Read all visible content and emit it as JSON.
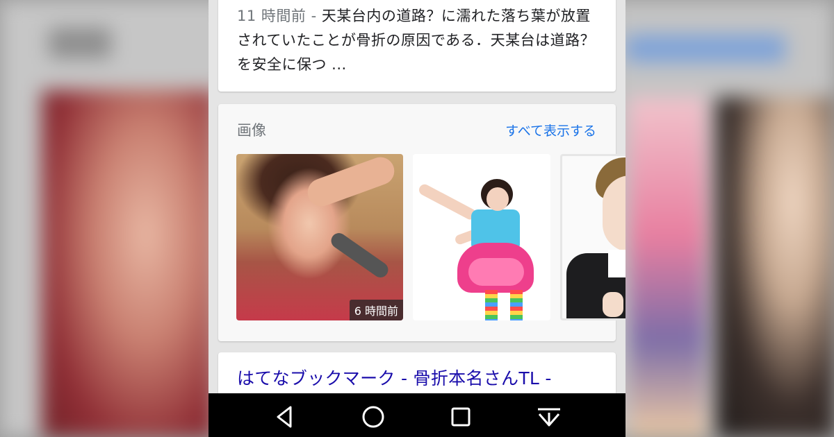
{
  "snippet": {
    "timestamp": "11 時間前 - ",
    "text": "天某台内の道路？に濡れた落ち葉が放置されていたことが骨折の原因である．天某台は道路？を安全に保つ ..."
  },
  "images_section": {
    "title": "画像",
    "show_all": "すべて表示する",
    "thumbnails": [
      {
        "icon": "singer-with-microphone-photo",
        "badge": "6 時間前"
      },
      {
        "icon": "colorful-costume-dancer-photo"
      },
      {
        "icon": "person-in-black-suit-photo"
      }
    ]
  },
  "result": {
    "link_text": "はてなブックマーク - 骨折本名さんTL -"
  },
  "navbar": {
    "buttons": [
      {
        "icon": "back-icon"
      },
      {
        "icon": "home-icon"
      },
      {
        "icon": "recent-apps-icon"
      },
      {
        "icon": "hide-nav-icon"
      }
    ]
  }
}
